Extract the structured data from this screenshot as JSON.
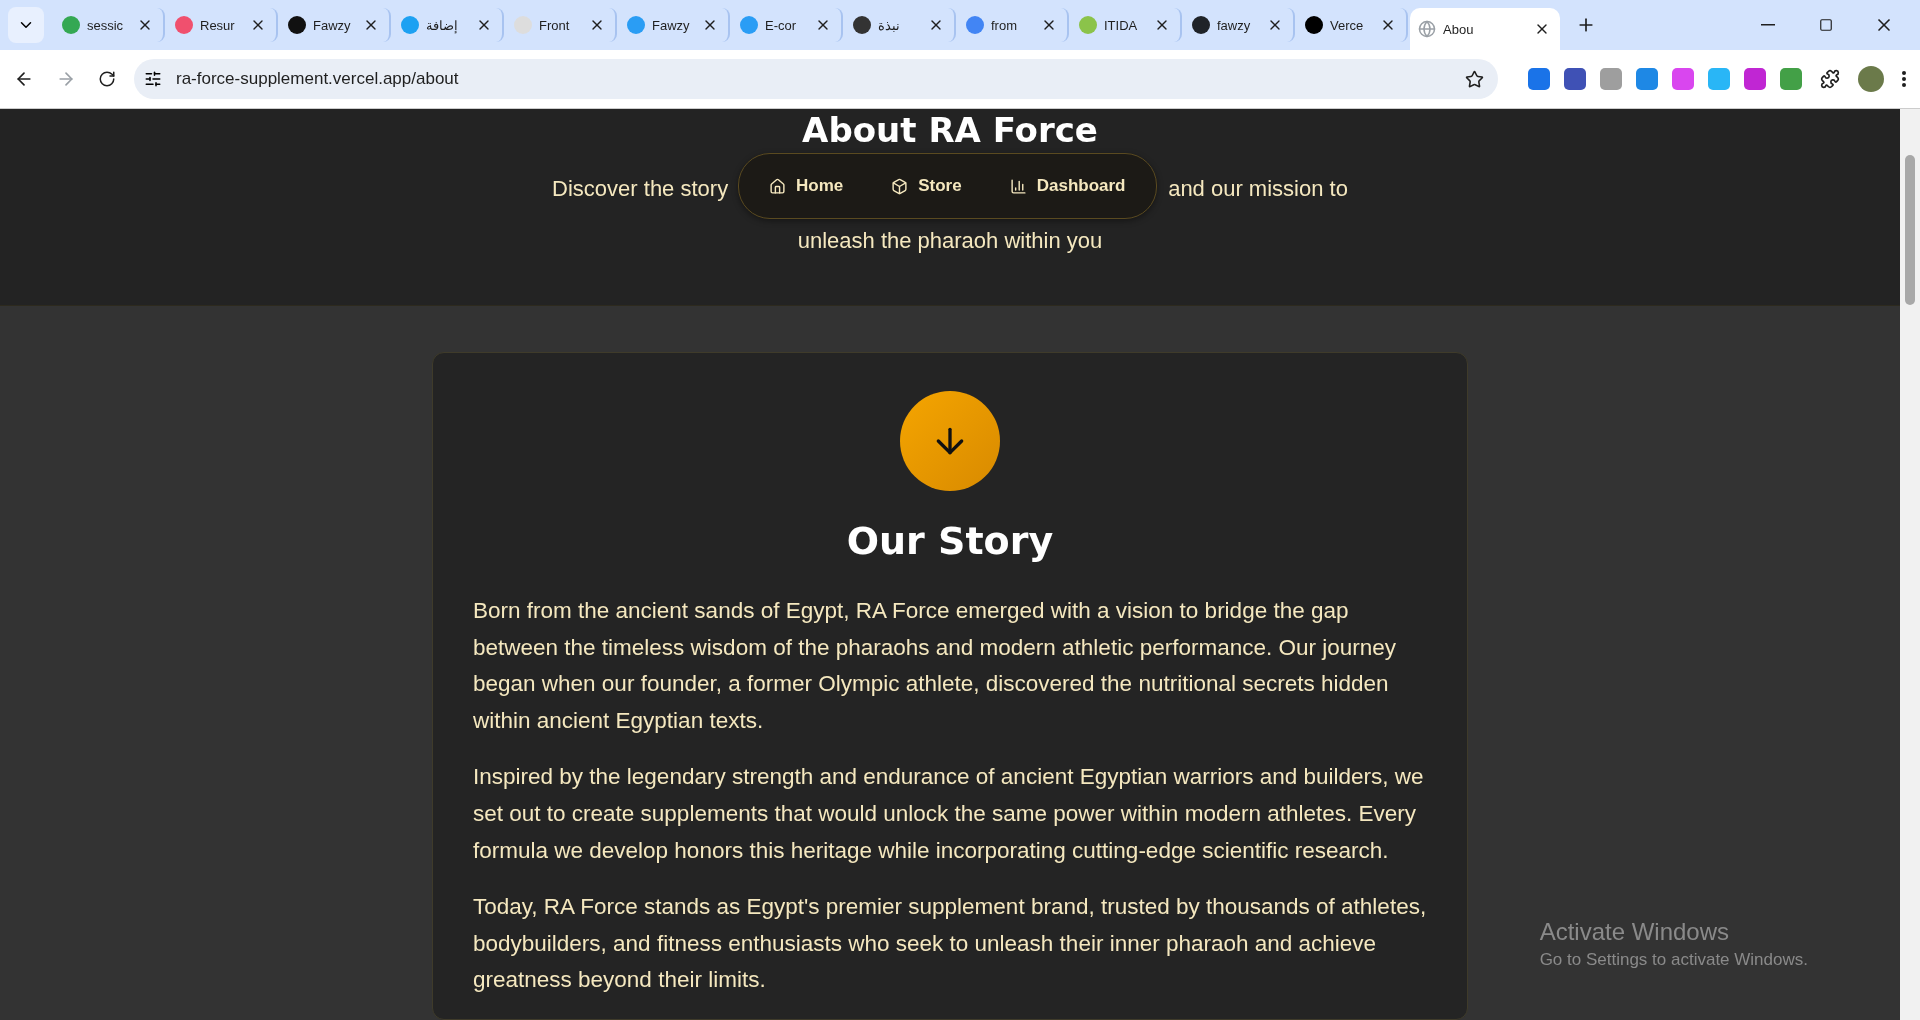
{
  "browser": {
    "tabs": [
      {
        "title": "sessic",
        "color": "#34a853",
        "selected": false
      },
      {
        "title": "Resur",
        "color": "#f0506e",
        "selected": false
      },
      {
        "title": "Fawzy",
        "color": "#111111",
        "selected": false
      },
      {
        "title": "إضافة",
        "color": "#1da1f2",
        "selected": false
      },
      {
        "title": "Front",
        "color": "#dddddd",
        "selected": false
      },
      {
        "title": "Fawzy",
        "color": "#2a9df4",
        "selected": false
      },
      {
        "title": "E-cor",
        "color": "#2a9df5",
        "selected": false
      },
      {
        "title": "نبذة",
        "color": "#333333",
        "selected": false
      },
      {
        "title": "from",
        "color": "#4285f4",
        "selected": false
      },
      {
        "title": "ITIDA",
        "color": "#8bc34a",
        "selected": false
      },
      {
        "title": "fawzy",
        "color": "#1f2328",
        "selected": false
      },
      {
        "title": "Verce",
        "color": "#000000",
        "selected": false
      },
      {
        "title": "Abou",
        "color": "#9aa0a6",
        "selected": true
      }
    ],
    "address": "ra-force-supplement.vercel.app/about",
    "extensions": [
      {
        "color": "#1a73e8"
      },
      {
        "color": "#3f51b5"
      },
      {
        "color": "#9e9e9e"
      },
      {
        "color": "#1e88e5"
      },
      {
        "color": "#d946ef"
      },
      {
        "color": "#29b6f6"
      },
      {
        "color": "#c026d3"
      },
      {
        "color": "#43a047"
      }
    ]
  },
  "page": {
    "header": {
      "title": "About RA Force",
      "subtitle_left": "Discover the story",
      "subtitle_right": "and our mission to",
      "subtitle_line2": "unleash the pharaoh within you"
    },
    "nav": [
      {
        "label": "Home",
        "kind": "home"
      },
      {
        "label": "Store",
        "kind": "store"
      },
      {
        "label": "Dashboard",
        "kind": "dashboard"
      }
    ],
    "story": {
      "title": "Our Story",
      "paragraphs": [
        "Born from the ancient sands of Egypt, RA Force emerged with a vision to bridge the gap between the timeless wisdom of the pharaohs and modern athletic performance. Our journey began when our founder, a former Olympic athlete, discovered the nutritional secrets hidden within ancient Egyptian texts.",
        "Inspired by the legendary strength and endurance of ancient Egyptian warriors and builders, we set out to create supplements that would unlock the same power within modern athletes. Every formula we develop honors this heritage while incorporating cutting-edge scientific research.",
        "Today, RA Force stands as Egypt's premier supplement brand, trusted by thousands of athletes, bodybuilders, and fitness enthusiasts who seek to unleash their inner pharaoh and achieve greatness beyond their limits."
      ]
    }
  },
  "os_notice": {
    "title": "Activate Windows",
    "text": "Go to Settings to activate Windows."
  }
}
